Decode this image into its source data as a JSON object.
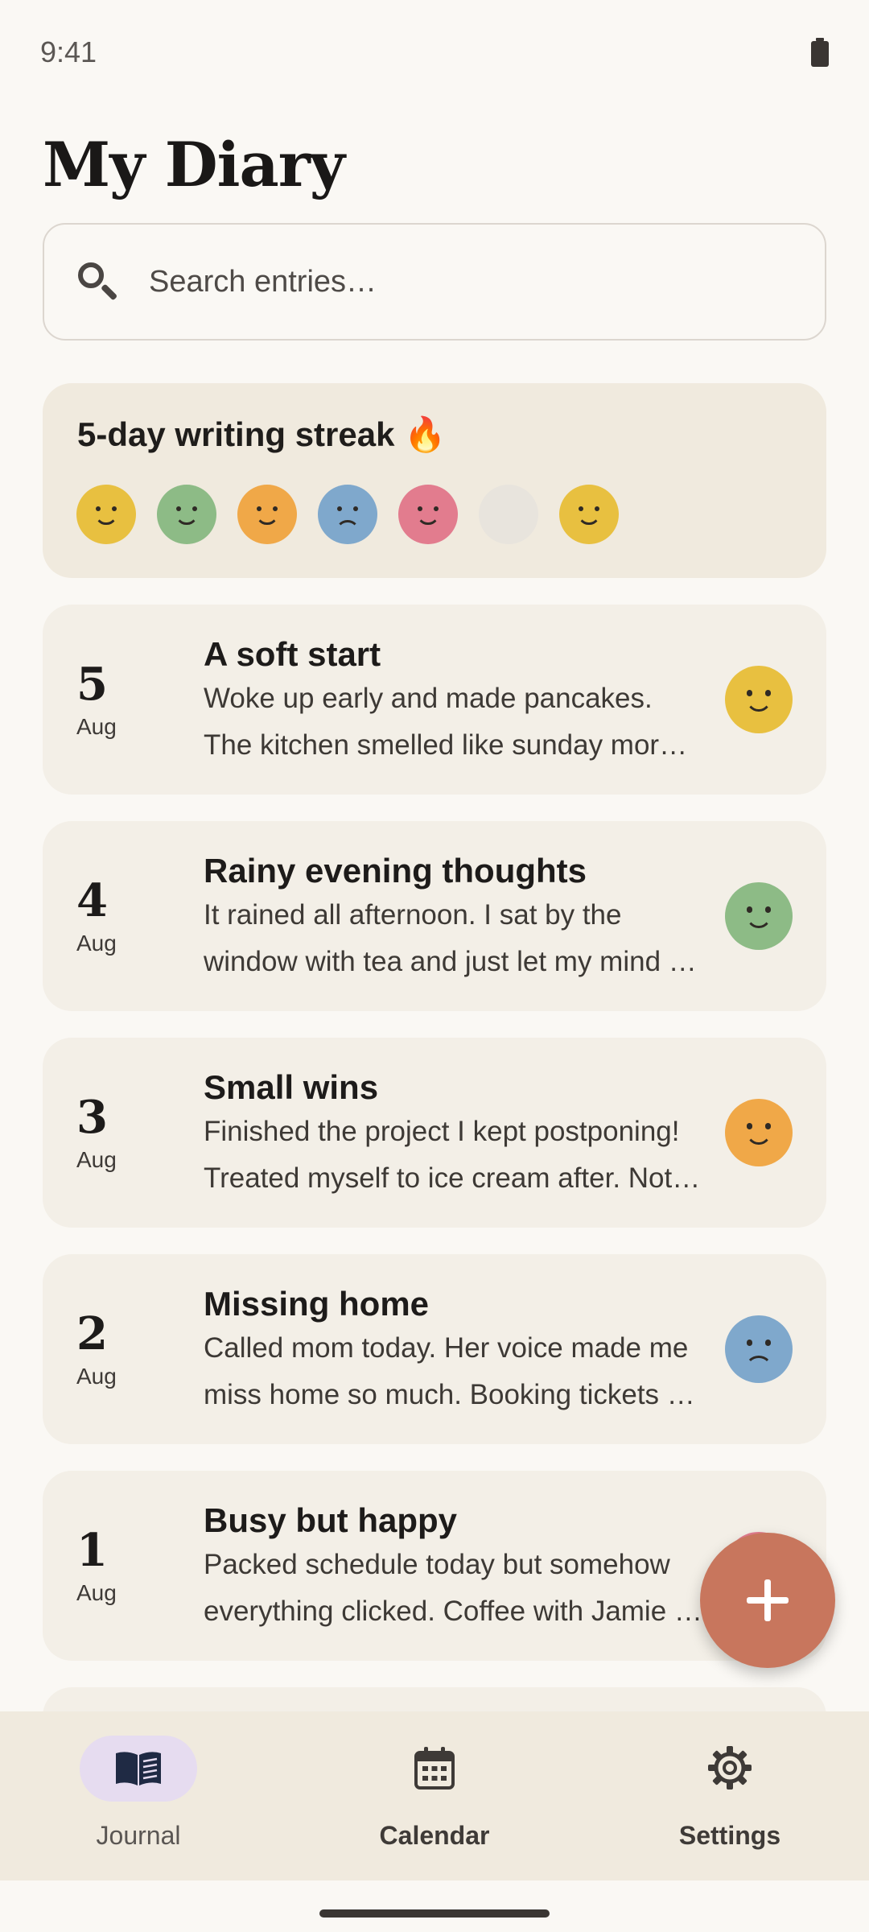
{
  "status_bar": {
    "time": "9:41"
  },
  "page": {
    "title": "My Diary"
  },
  "search": {
    "placeholder": "Search entries…"
  },
  "streak": {
    "title": "5-day writing streak 🔥",
    "moods": [
      {
        "mood": "happy",
        "color": "#e8c040"
      },
      {
        "mood": "content",
        "color": "#8dbb86"
      },
      {
        "mood": "cheerful",
        "color": "#f0a848"
      },
      {
        "mood": "sad",
        "color": "#7fa8cc"
      },
      {
        "mood": "loving",
        "color": "#e27c8e"
      },
      {
        "mood": "none",
        "color": "#e8e4dd"
      },
      {
        "mood": "happy",
        "color": "#e8c040"
      }
    ]
  },
  "entries": [
    {
      "day": "5",
      "month": "Aug",
      "title": "A soft start",
      "line1": "Woke up early and made pancakes.",
      "line2": "The kitchen smelled like sunday mornings and cinnamon",
      "mood": "happy",
      "mood_color": "#e8c040"
    },
    {
      "day": "4",
      "month": "Aug",
      "title": "Rainy evening thoughts",
      "line1": "It rained all afternoon. I sat by the",
      "line2": "window with tea and just let my mind wander away",
      "mood": "content",
      "mood_color": "#8dbb86"
    },
    {
      "day": "3",
      "month": "Aug",
      "title": "Small wins",
      "line1": "Finished the project I kept postponing!",
      "line2": "Treated myself to ice cream after. Not bad at all",
      "mood": "cheerful",
      "mood_color": "#f0a848"
    },
    {
      "day": "2",
      "month": "Aug",
      "title": "Missing home",
      "line1": "Called mom today. Her voice made me",
      "line2": "miss home so much. Booking tickets soon for a visit",
      "mood": "sad",
      "mood_color": "#7fa8cc"
    },
    {
      "day": "1",
      "month": "Aug",
      "title": "Busy but happy",
      "line1": "Packed schedule today but somehow",
      "line2": "everything clicked. Coffee with Jamie was great",
      "mood": "loving",
      "mood_color": "#e27c8e"
    }
  ],
  "fab": {
    "icon": "plus-icon",
    "color": "#c8765d"
  },
  "nav": {
    "items": [
      {
        "label": "Journal",
        "icon": "book-icon",
        "active": true
      },
      {
        "label": "Calendar",
        "icon": "calendar-icon",
        "active": false
      },
      {
        "label": "Settings",
        "icon": "gear-icon",
        "active": false
      }
    ]
  }
}
